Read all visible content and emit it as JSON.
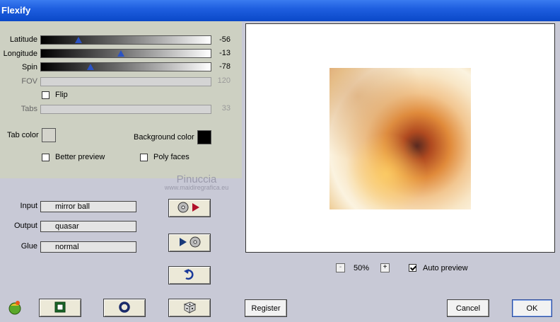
{
  "window": {
    "title": "Flexify"
  },
  "sliders": [
    {
      "label": "Latitude",
      "value": "-56",
      "level": 0.22,
      "enabled": true
    },
    {
      "label": "Longitude",
      "value": "-13",
      "level": 0.47,
      "enabled": true
    },
    {
      "label": "Spin",
      "value": "-78",
      "level": 0.29,
      "enabled": true
    },
    {
      "label": "FOV",
      "value": "120",
      "enabled": false
    },
    {
      "label": "Tabs",
      "value": "33",
      "enabled": false
    }
  ],
  "flip": {
    "label": "Flip",
    "checked": false
  },
  "tab_color": {
    "label": "Tab color",
    "color": "#d4d4cc"
  },
  "background_color": {
    "label": "Background color",
    "color": "#000000"
  },
  "better_preview": {
    "label": "Better preview",
    "checked": false
  },
  "poly_faces": {
    "label": "Poly faces",
    "checked": false
  },
  "watermark": {
    "line1": "Pinuccia",
    "line2": "www.maidiregrafica.eu"
  },
  "input": {
    "label": "Input",
    "value": "mirror ball"
  },
  "output": {
    "label": "Output",
    "value": "quasar"
  },
  "glue": {
    "label": "Glue",
    "value": "normal"
  },
  "zoom": {
    "minus": "-",
    "value": "50%",
    "plus": "+"
  },
  "auto_preview": {
    "label": "Auto preview",
    "checked": true
  },
  "buttons": {
    "register": "Register",
    "cancel": "Cancel",
    "ok": "OK"
  },
  "icons": [
    "export-to-icon",
    "import-from-icon",
    "reset-icon",
    "random-dice-icon",
    "app-logo-icon",
    "square-icon",
    "ring-icon"
  ]
}
